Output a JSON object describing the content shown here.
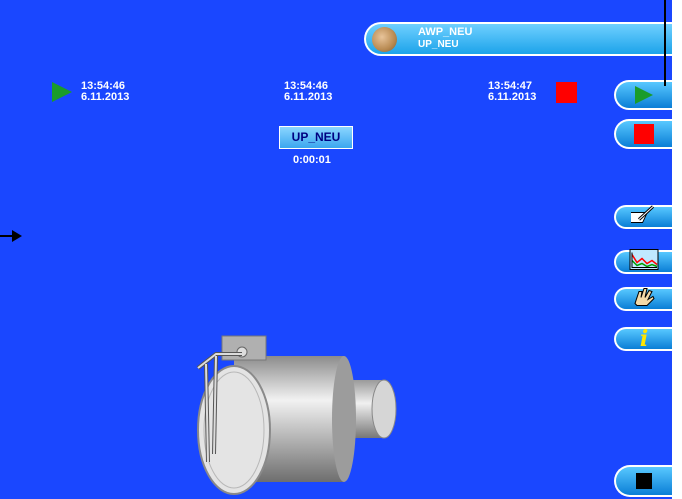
{
  "header": {
    "title": "AWP_NEU",
    "subtitle": "UP_NEU"
  },
  "timestamps": {
    "start": {
      "time": "13:54:46",
      "date": "6.11.2013"
    },
    "middle": {
      "time": "13:54:46",
      "date": "6.11.2013"
    },
    "end": {
      "time": "13:54:47",
      "date": "6.11.2013"
    }
  },
  "program": {
    "button_label": "UP_NEU",
    "elapsed": "0:00:01"
  },
  "side_buttons": [
    {
      "name": "start-button",
      "icon": "play-icon"
    },
    {
      "name": "stop-button",
      "icon": "stop-icon"
    },
    {
      "name": "edit-button",
      "icon": "pen-icon"
    },
    {
      "name": "graph-button",
      "icon": "chart-icon"
    },
    {
      "name": "manual-button",
      "icon": "hand-icon"
    },
    {
      "name": "info-button",
      "icon": "info-icon"
    },
    {
      "name": "exit-button",
      "icon": "square-icon"
    }
  ],
  "colors": {
    "background": "#1a47ff",
    "play": "#1a9c2a",
    "stop": "#ff0000",
    "button": "#1ca3ea"
  }
}
